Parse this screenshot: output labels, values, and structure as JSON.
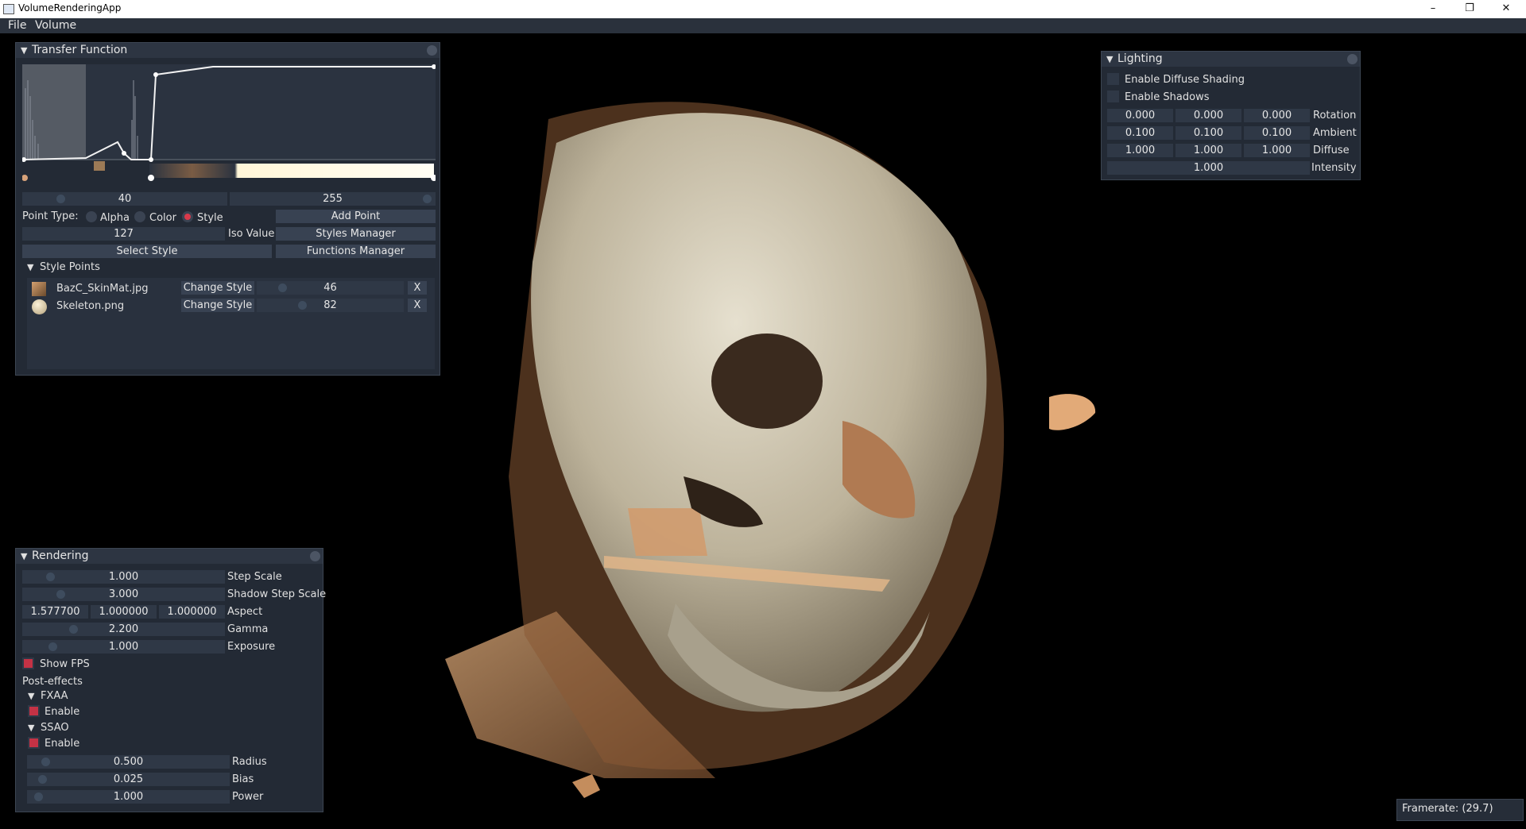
{
  "window": {
    "title": "VolumeRenderingApp",
    "minimize": "–",
    "restore": "❐",
    "close": "✕"
  },
  "menu": {
    "items": [
      "File",
      "Volume"
    ]
  },
  "transfer_function": {
    "title": "Transfer Function",
    "range_min": "40",
    "range_max": "255",
    "point_type_label": "Point Type:",
    "point_types": [
      "Alpha",
      "Color",
      "Style"
    ],
    "selected_point_type": "Style",
    "add_point": "Add Point",
    "iso_value": "127",
    "iso_value_label": "Iso Value",
    "styles_manager": "Styles Manager",
    "select_style": "Select Style",
    "functions_manager": "Functions Manager",
    "style_points_header": "Style Points",
    "style_points": [
      {
        "name": "BazC_SkinMat.jpg",
        "change": "Change Style",
        "value": "46",
        "remove": "X"
      },
      {
        "name": "Skeleton.png",
        "change": "Change Style",
        "value": "82",
        "remove": "X"
      }
    ]
  },
  "lighting": {
    "title": "Lighting",
    "enable_diffuse": "Enable Diffuse Shading",
    "enable_shadows": "Enable Shadows",
    "rows": [
      {
        "label": "Rotation",
        "values": [
          "0.000",
          "0.000",
          "0.000"
        ]
      },
      {
        "label": "Ambient",
        "values": [
          "0.100",
          "0.100",
          "0.100"
        ]
      },
      {
        "label": "Diffuse",
        "values": [
          "1.000",
          "1.000",
          "1.000"
        ]
      }
    ],
    "intensity": {
      "label": "Intensity",
      "value": "1.000"
    }
  },
  "rendering": {
    "title": "Rendering",
    "step_scale": {
      "label": "Step Scale",
      "value": "1.000"
    },
    "shadow_step_scale": {
      "label": "Shadow Step Scale",
      "value": "3.000"
    },
    "aspect": {
      "label": "Aspect",
      "values": [
        "1.577700",
        "1.000000",
        "1.000000"
      ]
    },
    "gamma": {
      "label": "Gamma",
      "value": "2.200"
    },
    "exposure": {
      "label": "Exposure",
      "value": "1.000"
    },
    "show_fps": "Show FPS",
    "post_effects": "Post-effects",
    "fxaa": {
      "header": "FXAA",
      "enable": "Enable"
    },
    "ssao": {
      "header": "SSAO",
      "enable": "Enable",
      "radius": {
        "label": "Radius",
        "value": "0.500"
      },
      "bias": {
        "label": "Bias",
        "value": "0.025"
      },
      "power": {
        "label": "Power",
        "value": "1.000"
      }
    }
  },
  "framerate": "Framerate: (29.7)",
  "colors": {
    "panel_bg": "#232a35",
    "field_bg": "#2f3846",
    "button_bg": "#384252",
    "accent_red": "#c43245",
    "volume_bone": "#cfc6ad",
    "volume_skin": "#b98a60"
  }
}
